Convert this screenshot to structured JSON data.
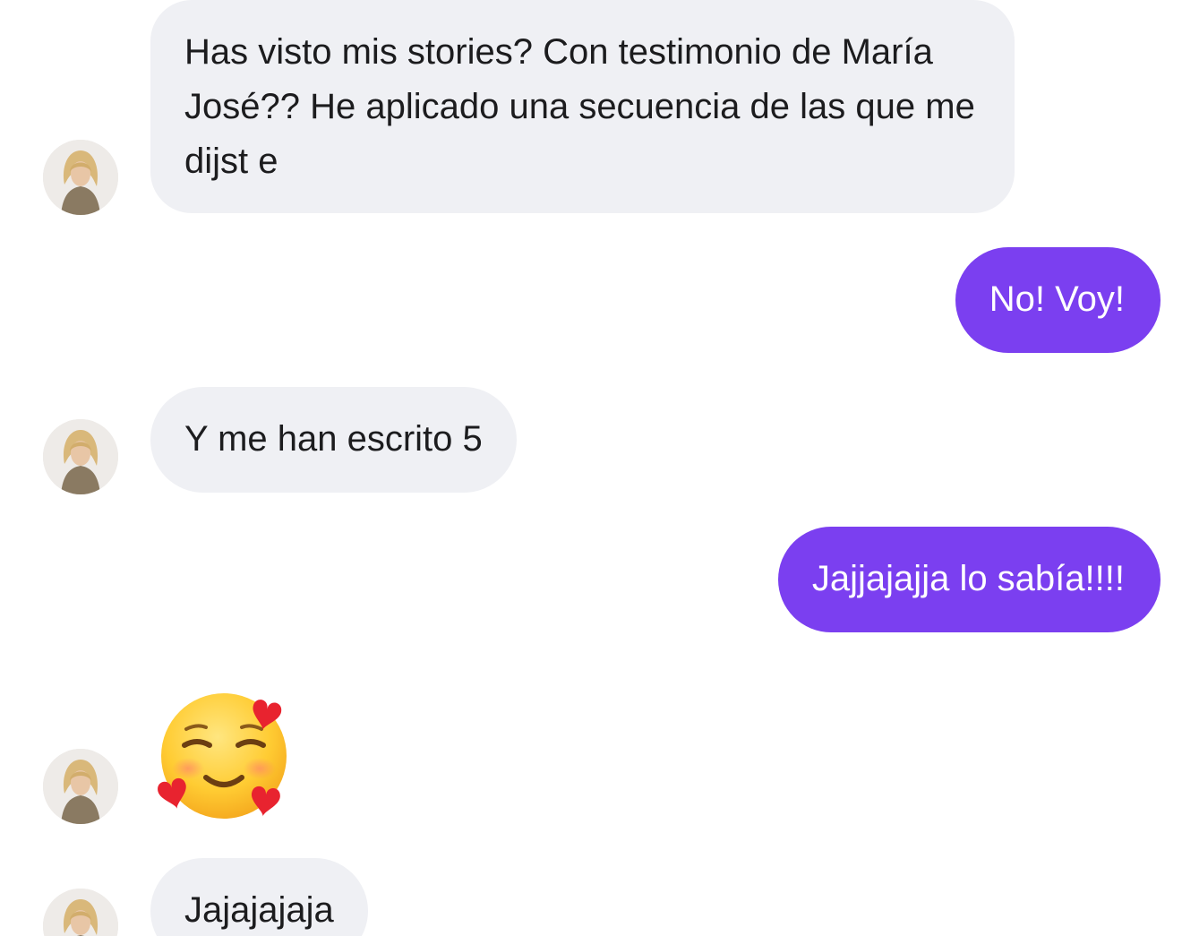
{
  "conversation": {
    "messages": [
      {
        "sender": "contact",
        "text": "Has visto mis stories? Con testimonio de María José?? He aplicado una secuencia de las que me dijst e"
      },
      {
        "sender": "me",
        "text": "No! Voy!"
      },
      {
        "sender": "contact",
        "text": "Y me han escrito 5"
      },
      {
        "sender": "me",
        "text": "Jajjajajja lo sabía!!!!"
      },
      {
        "sender": "contact",
        "emoji": "smiling-face-with-hearts-icon"
      },
      {
        "sender": "contact",
        "text": "Jajajajaja"
      }
    ]
  },
  "colors": {
    "incoming_bubble": "#eff0f4",
    "outgoing_bubble": "#7b3ff0",
    "outgoing_text": "#ffffff",
    "incoming_text": "#1c1c1e"
  }
}
